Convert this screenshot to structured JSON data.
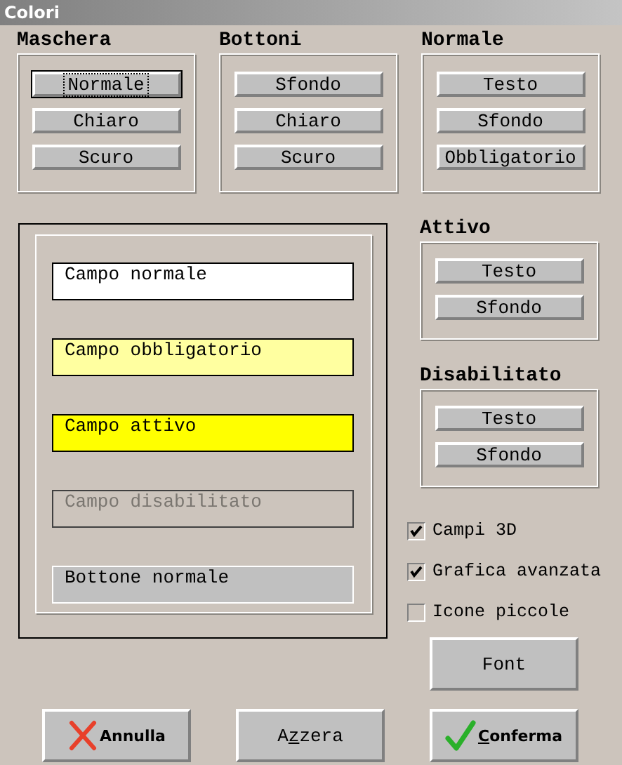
{
  "window": {
    "title": "Colori"
  },
  "groups": [
    {
      "title": "Maschera",
      "buttons": [
        {
          "label": "Normale",
          "focused": true
        },
        {
          "label": "Chiaro",
          "focused": false
        },
        {
          "label": "Scuro",
          "focused": false
        }
      ]
    },
    {
      "title": "Bottoni",
      "buttons": [
        {
          "label": "Sfondo",
          "focused": false
        },
        {
          "label": "Chiaro",
          "focused": false
        },
        {
          "label": "Scuro",
          "focused": false
        }
      ]
    },
    {
      "title": "Normale",
      "buttons": [
        {
          "label": "Testo",
          "focused": false
        },
        {
          "label": "Sfondo",
          "focused": false
        },
        {
          "label": "Obbligatorio",
          "focused": false
        }
      ]
    }
  ],
  "preview": {
    "fields": [
      {
        "label": "Campo normale",
        "kind": "normal"
      },
      {
        "label": "Campo obbligatorio",
        "kind": "required"
      },
      {
        "label": "Campo attivo",
        "kind": "active"
      },
      {
        "label": "Campo disabilitato",
        "kind": "disabled"
      },
      {
        "label": "Bottone normale",
        "kind": "button"
      }
    ]
  },
  "side_groups": [
    {
      "title": "Attivo",
      "buttons": [
        {
          "label": "Testo",
          "focused": false
        },
        {
          "label": "Sfondo",
          "focused": false
        }
      ]
    },
    {
      "title": "Disabilitato",
      "buttons": [
        {
          "label": "Testo",
          "focused": false
        },
        {
          "label": "Sfondo",
          "focused": false
        }
      ]
    }
  ],
  "options": [
    {
      "label": "Campi 3D",
      "checked": true
    },
    {
      "label": "Grafica avanzata",
      "checked": true
    },
    {
      "label": "Icone piccole",
      "checked": false
    }
  ],
  "font_button": {
    "label": "Font"
  },
  "actions": [
    {
      "label": "Annulla",
      "kind": "cancel"
    },
    {
      "kind": "reset",
      "label_parts": {
        "before": "A",
        "access_key": "z",
        "after": "zera"
      }
    },
    {
      "kind": "confirm",
      "label_parts": {
        "access_key": "C",
        "after": "onferma"
      }
    }
  ]
}
